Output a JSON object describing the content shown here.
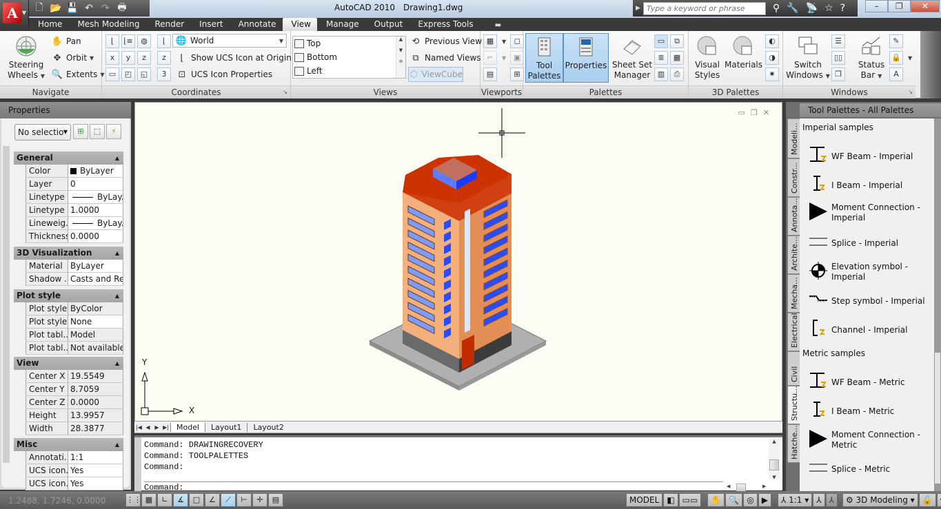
{
  "window": {
    "app_title": "AutoCAD 2010",
    "document_title": "Drawing1.dwg",
    "search_placeholder": "Type a keyword or phrase",
    "controls": {
      "minimize": "–",
      "restore": "❐",
      "close": "✕"
    }
  },
  "quick_access": {
    "icons": [
      "new-icon",
      "open-icon",
      "save-icon",
      "undo-icon",
      "redo-icon",
      "plot-icon"
    ],
    "glyphs": [
      "🗋",
      "📂",
      "💾",
      "↶",
      "↷",
      "🖶"
    ]
  },
  "app_menu": {
    "logo_letter": "A"
  },
  "ribbon_tabs": [
    {
      "label": "Home",
      "active": false
    },
    {
      "label": "Mesh Modeling",
      "active": false
    },
    {
      "label": "Render",
      "active": false
    },
    {
      "label": "Insert",
      "active": false
    },
    {
      "label": "Annotate",
      "active": false
    },
    {
      "label": "View",
      "active": true
    },
    {
      "label": "Manage",
      "active": false
    },
    {
      "label": "Output",
      "active": false
    },
    {
      "label": "Express Tools",
      "active": false
    }
  ],
  "ribbon": {
    "navigate": {
      "title": "Navigate",
      "steering_wheels_line1": "Steering",
      "steering_wheels_line2": "Wheels",
      "pan": "Pan",
      "orbit": "Orbit",
      "extents": "Extents"
    },
    "coordinates": {
      "title": "Coordinates",
      "ucs_combo": "World",
      "show_ucs": "Show UCS Icon at Origin",
      "ucs_props": "UCS Icon Properties"
    },
    "views": {
      "title": "Views",
      "list": [
        "Top",
        "Bottom",
        "Left"
      ],
      "previous_view": "Previous View",
      "named_views": "Named Views",
      "viewcube": "ViewCube"
    },
    "viewports": {
      "title": "Viewports"
    },
    "palettes": {
      "title": "Palettes",
      "tool_palettes_line1": "Tool",
      "tool_palettes_line2": "Palettes",
      "properties": "Properties",
      "sheet_set_line1": "Sheet Set",
      "sheet_set_line2": "Manager"
    },
    "palettes3d": {
      "title": "3D Palettes",
      "visual_styles_line1": "Visual",
      "visual_styles_line2": "Styles",
      "materials": "Materials"
    },
    "windows": {
      "title": "Windows",
      "switch_line1": "Switch",
      "switch_line2": "Windows",
      "status_line1": "Status",
      "status_line2": "Bar"
    }
  },
  "properties_panel": {
    "title": "Properties",
    "selection": "No selectio",
    "sections": [
      {
        "name": "General",
        "rows": [
          {
            "key": "Color",
            "value": "ByLayer",
            "type": "color"
          },
          {
            "key": "Layer",
            "value": "0"
          },
          {
            "key": "Linetype",
            "value": "ByLay...",
            "type": "line"
          },
          {
            "key": "Linetype ...",
            "value": "1.0000"
          },
          {
            "key": "Lineweig...",
            "value": "ByLay...",
            "type": "line"
          },
          {
            "key": "Thickness",
            "value": "0.0000"
          }
        ]
      },
      {
        "name": "3D Visualization",
        "rows": [
          {
            "key": "Material",
            "value": "ByLayer"
          },
          {
            "key": "Shadow ...",
            "value": "Casts and Re..."
          }
        ]
      },
      {
        "name": "Plot style",
        "rows": [
          {
            "key": "Plot style",
            "value": "ByColor",
            "ro": true
          },
          {
            "key": "Plot style...",
            "value": "None"
          },
          {
            "key": "Plot tabl...",
            "value": "Model",
            "ro": true
          },
          {
            "key": "Plot tabl...",
            "value": "Not available",
            "ro": true
          }
        ]
      },
      {
        "name": "View",
        "rows": [
          {
            "key": "Center X",
            "value": "19.5549",
            "ro": true
          },
          {
            "key": "Center Y",
            "value": "8.7059",
            "ro": true
          },
          {
            "key": "Center Z",
            "value": "0.0000",
            "ro": true
          },
          {
            "key": "Height",
            "value": "13.9957",
            "ro": true
          },
          {
            "key": "Width",
            "value": "28.3877",
            "ro": true
          }
        ]
      },
      {
        "name": "Misc",
        "rows": [
          {
            "key": "Annotati...",
            "value": "1:1"
          },
          {
            "key": "UCS icon...",
            "value": "Yes"
          },
          {
            "key": "UCS icon...",
            "value": "Yes"
          }
        ]
      }
    ]
  },
  "canvas": {
    "ucs_x": "X",
    "ucs_y": "Y",
    "colors": {
      "roof": "#cc3300",
      "wall": "#f0a070",
      "glass": "#2a4cff",
      "base": "#aaaaaa"
    }
  },
  "layout_tabs": [
    {
      "label": "Model",
      "active": true
    },
    {
      "label": "Layout1",
      "active": false
    },
    {
      "label": "Layout2",
      "active": false
    }
  ],
  "command_line": {
    "history": [
      "Command: DRAWINGRECOVERY",
      "Command: TOOLPALETTES",
      "Command:"
    ],
    "prompt": "Command:"
  },
  "tool_palettes": {
    "title": "Tool Palettes - All Palettes",
    "tabs": [
      "Modeli...",
      "Constr...",
      "Annota...",
      "Archite...",
      "Mecha...",
      "Electrical",
      "Civil",
      "Structu...",
      "Hatche..."
    ],
    "active_tab": "Structu...",
    "categories": [
      {
        "name": "Imperial samples",
        "items": [
          {
            "label": "WF Beam - Imperial",
            "icon": "wf-beam-icon"
          },
          {
            "label": "I Beam - Imperial",
            "icon": "i-beam-icon"
          },
          {
            "label": "Moment Connection - Imperial",
            "icon": "moment-connection-icon"
          },
          {
            "label": "Splice - Imperial",
            "icon": "splice-icon"
          },
          {
            "label": "Elevation symbol - Imperial",
            "icon": "elevation-symbol-icon"
          },
          {
            "label": "Step symbol - Imperial",
            "icon": "step-symbol-icon"
          },
          {
            "label": "Channel - Imperial",
            "icon": "channel-icon"
          }
        ]
      },
      {
        "name": "Metric samples",
        "items": [
          {
            "label": "WF Beam - Metric",
            "icon": "wf-beam-icon"
          },
          {
            "label": "I Beam - Metric",
            "icon": "i-beam-icon"
          },
          {
            "label": "Moment Connection - Metric",
            "icon": "moment-connection-icon"
          },
          {
            "label": "Splice - Metric",
            "icon": "splice-icon"
          }
        ]
      }
    ]
  },
  "status_bar": {
    "coordinates": "1.2488, 1.7246, 0.0000",
    "toggles": [
      {
        "name": "snap-mode",
        "glyph": "⋮⋮",
        "on": false
      },
      {
        "name": "grid-display",
        "glyph": "▦",
        "on": false
      },
      {
        "name": "ortho-mode",
        "glyph": "∟",
        "on": false
      },
      {
        "name": "polar-tracking",
        "glyph": "∡",
        "on": true
      },
      {
        "name": "object-snap",
        "glyph": "□",
        "on": false
      },
      {
        "name": "3d-object-snap",
        "glyph": "∠",
        "on": false
      },
      {
        "name": "object-snap-tracking",
        "glyph": "⟋",
        "on": true
      },
      {
        "name": "dynamic-ucs",
        "glyph": "⊢",
        "on": false
      },
      {
        "name": "dynamic-input",
        "glyph": "✛",
        "on": false
      },
      {
        "name": "lineweight",
        "glyph": "▤",
        "on": false
      }
    ],
    "model_label": "MODEL",
    "annotation_scale": "1:1",
    "workspace": "3D Modeling"
  }
}
